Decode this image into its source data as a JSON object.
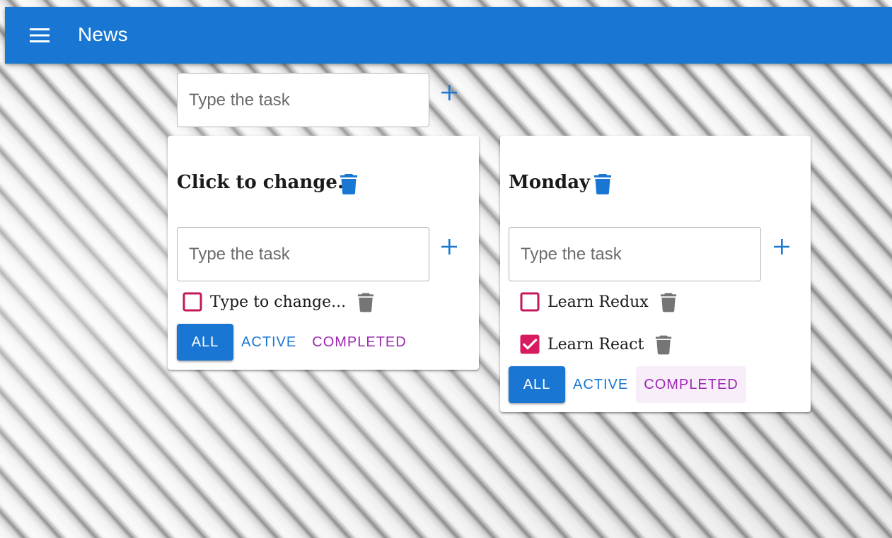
{
  "appbar": {
    "title": "News",
    "menu_icon": "menu-icon"
  },
  "new_list": {
    "placeholder": "Type the task",
    "add_icon": "plus-icon"
  },
  "lists": [
    {
      "title": "Click to change...",
      "input_placeholder": "Type the task",
      "tasks": [
        {
          "label": "Type to change...",
          "checked": false
        }
      ],
      "filters": {
        "all": "ALL",
        "active": "ACTIVE",
        "completed": "COMPLETED",
        "selected": "ALL"
      }
    },
    {
      "title": "Monday",
      "input_placeholder": "Type the task",
      "tasks": [
        {
          "label": "Learn Redux",
          "checked": false
        },
        {
          "label": "Learn React",
          "checked": true
        }
      ],
      "filters": {
        "all": "ALL",
        "active": "ACTIVE",
        "completed": "COMPLETED",
        "selected": "ALL"
      }
    }
  ],
  "colors": {
    "primary": "#1976d2",
    "secondary": "#9c27b0",
    "checkbox": "#c2185b",
    "trash_grey": "#757575"
  }
}
